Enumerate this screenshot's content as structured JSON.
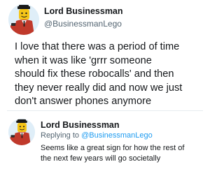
{
  "tweet": {
    "author_name": "Lord Businessman",
    "author_handle": "@BusinessmanLego",
    "avatar_icon": "lego-businessman-avatar-icon",
    "text": "I love that there was a period of time\nwhen it was like 'grrr someone\nshould fix these robocalls' and then\nthey never really did and now we just\ndon't answer phones anymore"
  },
  "reply": {
    "author_name": "Lord Businessman",
    "replying_prefix": "Replying to ",
    "replying_handle": "@BusinessmanLego",
    "avatar_icon": "lego-businessman-avatar-icon",
    "text": "Seems like a great sign for how the rest of\nthe next few years will go societally"
  },
  "colors": {
    "mention": "#1d9bf0",
    "secondary_text": "#536471",
    "divider": "#e6ecf0"
  }
}
